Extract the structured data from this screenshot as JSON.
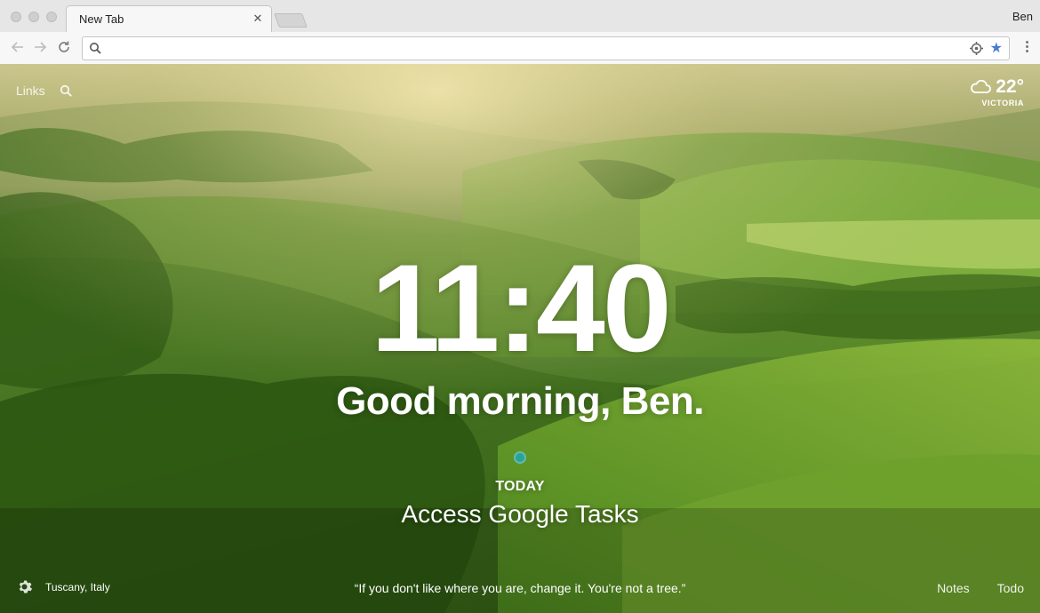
{
  "browser": {
    "tab_title": "New Tab",
    "tab_close": "✕",
    "profile_name": "Ben",
    "omnibox_value": ""
  },
  "momentum": {
    "links_label": "Links",
    "weather": {
      "temperature": "22°",
      "city": "VICTORIA"
    },
    "clock": "11:40",
    "greeting": "Good morning, Ben.",
    "focus": {
      "label": "TODAY",
      "task": "Access Google Tasks"
    },
    "photo_location": "Tuscany, Italy",
    "quote": "“If you don't like where you are, change it. You're not a tree.”",
    "bottom_links": {
      "notes": "Notes",
      "todo": "Todo"
    }
  },
  "colors": {
    "focus_dot": "#2aa394",
    "star": "#4a7bd0"
  },
  "icons": [
    "search-icon",
    "location-icon",
    "star-icon",
    "cloud-icon",
    "gear-icon",
    "back-arrow-icon",
    "forward-arrow-icon",
    "reload-icon",
    "close-icon"
  ]
}
